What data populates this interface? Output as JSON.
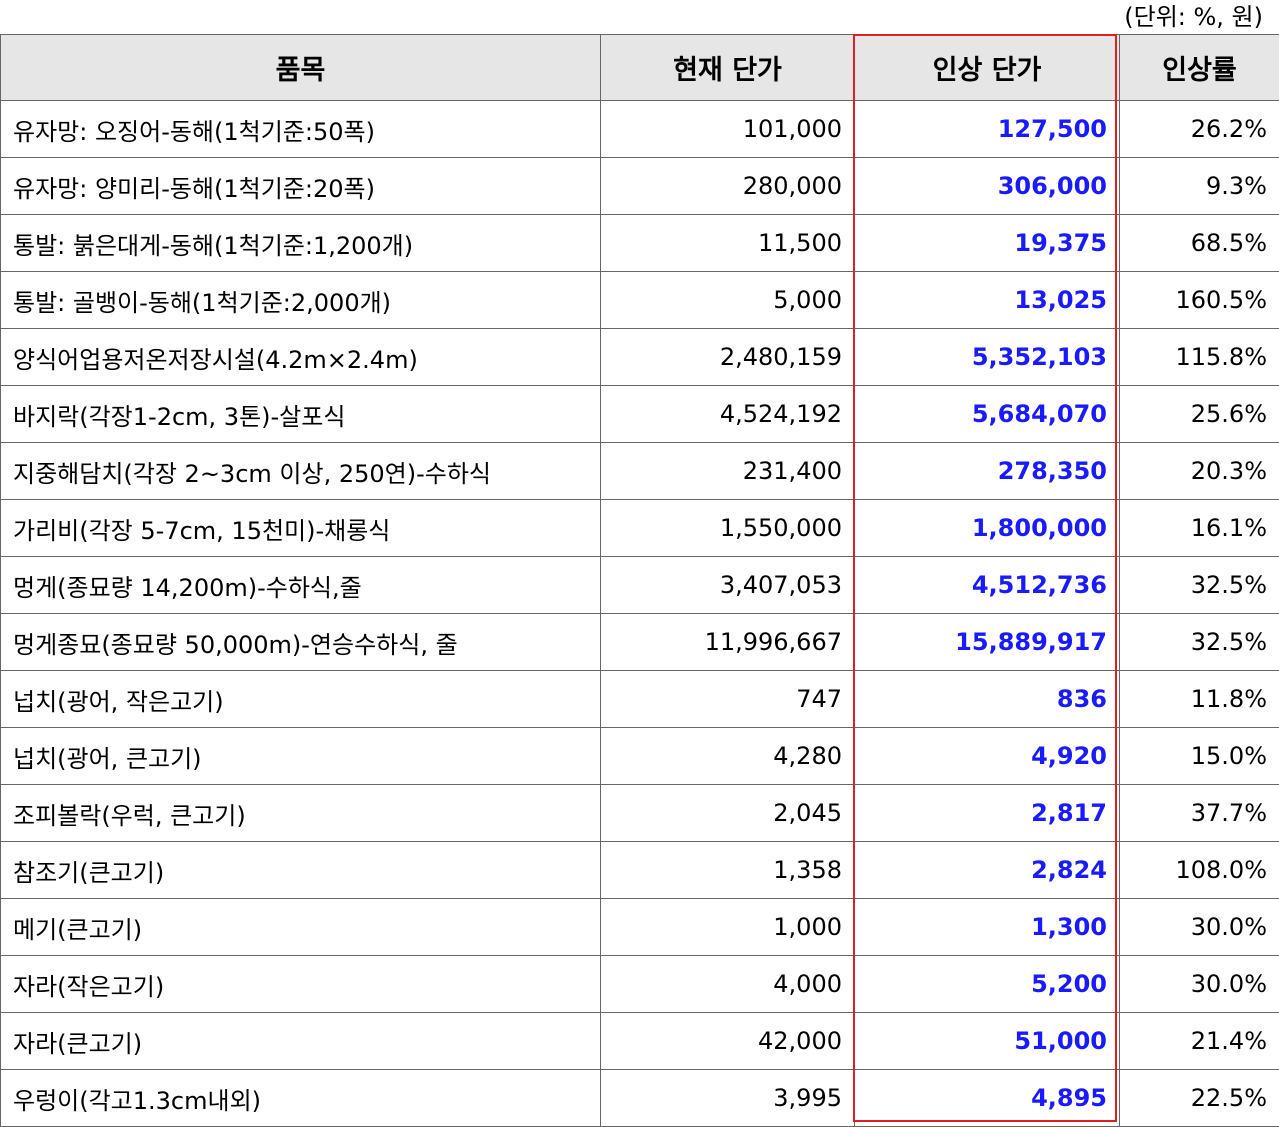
{
  "unit_note": "(단위: %, 원)",
  "accent_colors": {
    "new_price_text": "#1a1aff",
    "highlight_frame": "#e02020",
    "header_bg": "#e7e6e6"
  },
  "headers": {
    "item": "품목",
    "current": "현재 단가",
    "new": "인상 단가",
    "rate": "인상률"
  },
  "rows": [
    {
      "item": "유자망: 오징어-동해(1척기준:50폭)",
      "current": "101,000",
      "new": "127,500",
      "rate": "26.2%"
    },
    {
      "item": "유자망: 양미리-동해(1척기준:20폭)",
      "current": "280,000",
      "new": "306,000",
      "rate": "9.3%"
    },
    {
      "item": "통발: 붉은대게-동해(1척기준:1,200개)",
      "current": "11,500",
      "new": "19,375",
      "rate": "68.5%"
    },
    {
      "item": "통발: 골뱅이-동해(1척기준:2,000개)",
      "current": "5,000",
      "new": "13,025",
      "rate": "160.5%"
    },
    {
      "item": "양식어업용저온저장시설(4.2m×2.4m)",
      "current": "2,480,159",
      "new": "5,352,103",
      "rate": "115.8%"
    },
    {
      "item": "바지락(각장1-2cm, 3톤)-살포식",
      "current": "4,524,192",
      "new": "5,684,070",
      "rate": "25.6%"
    },
    {
      "item": "지중해담치(각장 2~3cm 이상, 250연)-수하식",
      "current": "231,400",
      "new": "278,350",
      "rate": "20.3%"
    },
    {
      "item": "가리비(각장 5-7cm, 15천미)-채롱식",
      "current": "1,550,000",
      "new": "1,800,000",
      "rate": "16.1%"
    },
    {
      "item": "멍게(종묘량 14,200m)-수하식,줄",
      "current": "3,407,053",
      "new": "4,512,736",
      "rate": "32.5%"
    },
    {
      "item": "멍게종묘(종묘량 50,000m)-연승수하식, 줄",
      "current": "11,996,667",
      "new": "15,889,917",
      "rate": "32.5%"
    },
    {
      "item": "넙치(광어, 작은고기)",
      "current": "747",
      "new": "836",
      "rate": "11.8%"
    },
    {
      "item": "넙치(광어, 큰고기)",
      "current": "4,280",
      "new": "4,920",
      "rate": "15.0%"
    },
    {
      "item": "조피볼락(우럭, 큰고기)",
      "current": "2,045",
      "new": "2,817",
      "rate": "37.7%"
    },
    {
      "item": "참조기(큰고기)",
      "current": "1,358",
      "new": "2,824",
      "rate": "108.0%"
    },
    {
      "item": "메기(큰고기)",
      "current": "1,000",
      "new": "1,300",
      "rate": "30.0%"
    },
    {
      "item": "자라(작은고기)",
      "current": "4,000",
      "new": "5,200",
      "rate": "30.0%"
    },
    {
      "item": "자라(큰고기)",
      "current": "42,000",
      "new": "51,000",
      "rate": "21.4%"
    },
    {
      "item": "우렁이(각고1.3cm내외)",
      "current": "3,995",
      "new": "4,895",
      "rate": "22.5%"
    }
  ]
}
